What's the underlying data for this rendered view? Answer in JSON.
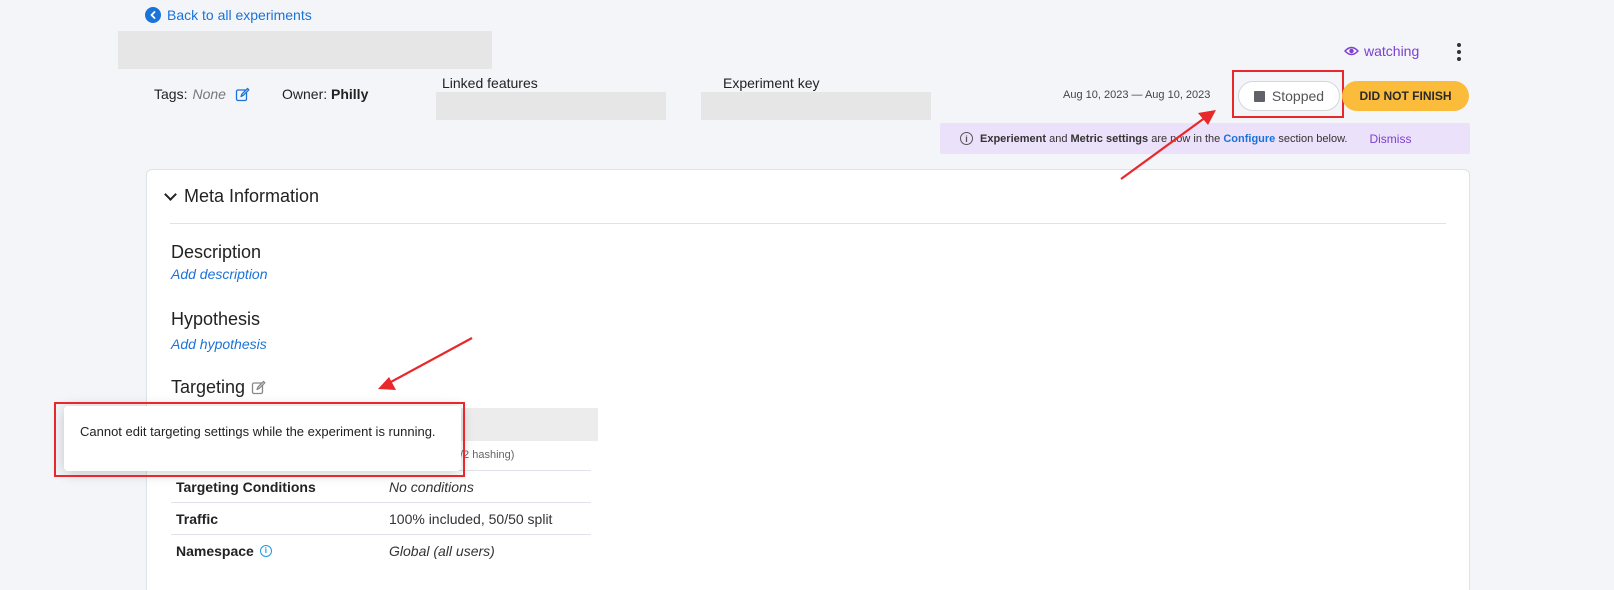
{
  "nav": {
    "back_label": "Back to all experiments"
  },
  "header": {
    "watching_label": "watching",
    "tags_label": "Tags:",
    "tags_value": "None",
    "owner_label": "Owner:",
    "owner_value": "Philly",
    "linked_features_label": "Linked features",
    "experiment_key_label": "Experiment key",
    "date_range": "Aug 10, 2023 — Aug 10, 2023",
    "status_label": "Stopped",
    "result_label": "DID NOT FINISH"
  },
  "notice": {
    "part1": "Experiement",
    "part2": " and ",
    "part3": "Metric settings",
    "part4": " are now in the ",
    "part5": "Configure",
    "part6": " section below.",
    "dismiss_label": "Dismiss"
  },
  "meta": {
    "heading": "Meta Information",
    "description_title": "Description",
    "description_link": "Add description",
    "hypothesis_title": "Hypothesis",
    "hypothesis_link": "Add hypothesis",
    "targeting_title": "Targeting"
  },
  "targeting_rows": [
    {
      "key": "Targeting Conditions",
      "value": "No conditions"
    },
    {
      "key": "Traffic",
      "value": "100% included, 50/50 split"
    },
    {
      "key": "Namespace",
      "value": "Global (all users)"
    }
  ],
  "hash_fragment": "/2 hashing)",
  "tooltip": {
    "text": "Cannot edit targeting settings while the experiment is running."
  },
  "colors": {
    "accent_blue": "#1a73d9",
    "purple": "#7c3fd1",
    "warning": "#fbbc3c",
    "annotation_red": "#e8282a"
  }
}
